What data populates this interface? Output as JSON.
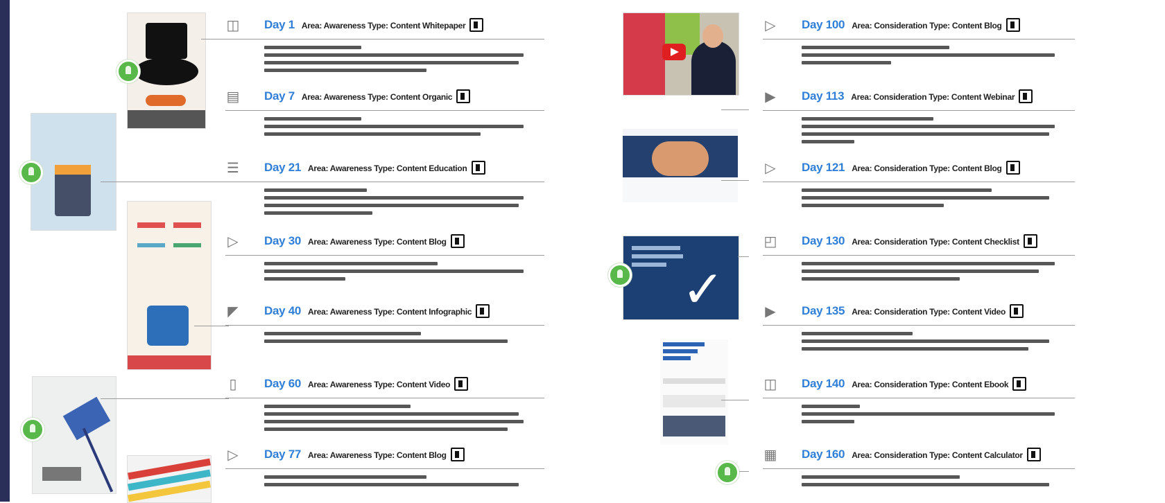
{
  "left_entries": [
    {
      "icon": "book-icon",
      "day": "Day 1",
      "meta": "Area: Awareness  Type: Content  Whitepaper"
    },
    {
      "icon": "document-icon",
      "day": "Day 7",
      "meta": "Area: Awareness  Type: Content  Organic"
    },
    {
      "icon": "document-search-icon",
      "day": "Day 21",
      "meta": "Area: Awareness  Type: Content  Education"
    },
    {
      "icon": "tag-icon",
      "day": "Day 30",
      "meta": "Area: Awareness  Type: Content  Blog"
    },
    {
      "icon": "document-fold-icon",
      "day": "Day 40",
      "meta": "Area: Awareness  Type: Content  Infographic"
    },
    {
      "icon": "tablet-icon",
      "day": "Day 60",
      "meta": "Area: Awareness  Type: Content  Video"
    },
    {
      "icon": "tag-icon",
      "day": "Day 77",
      "meta": "Area: Awareness  Type: Content  Blog"
    }
  ],
  "right_entries": [
    {
      "icon": "tag-icon",
      "day": "Day 100",
      "meta": "Area: Consideration  Type: Content  Blog"
    },
    {
      "icon": "play-circle-icon",
      "day": "Day 113",
      "meta": "Area: Consideration  Type: Content  Webinar"
    },
    {
      "icon": "tag-icon",
      "day": "Day 121",
      "meta": "Area: Consideration  Type: Content  Blog"
    },
    {
      "icon": "tags-icon",
      "day": "Day 130",
      "meta": "Area: Consideration  Type: Content  Checklist"
    },
    {
      "icon": "play-circle-icon",
      "day": "Day 135",
      "meta": "Area: Consideration  Type: Content  Video"
    },
    {
      "icon": "book-icon",
      "day": "Day 140",
      "meta": "Area: Consideration  Type: Content  Ebook"
    },
    {
      "icon": "calculator-icon",
      "day": "Day 160",
      "meta": "Area: Consideration  Type: Content  Calculator"
    }
  ],
  "colors": {
    "accent_blue": "#2f7fd8",
    "pin_green": "#59b84a",
    "edge": "#2a2f5a"
  }
}
